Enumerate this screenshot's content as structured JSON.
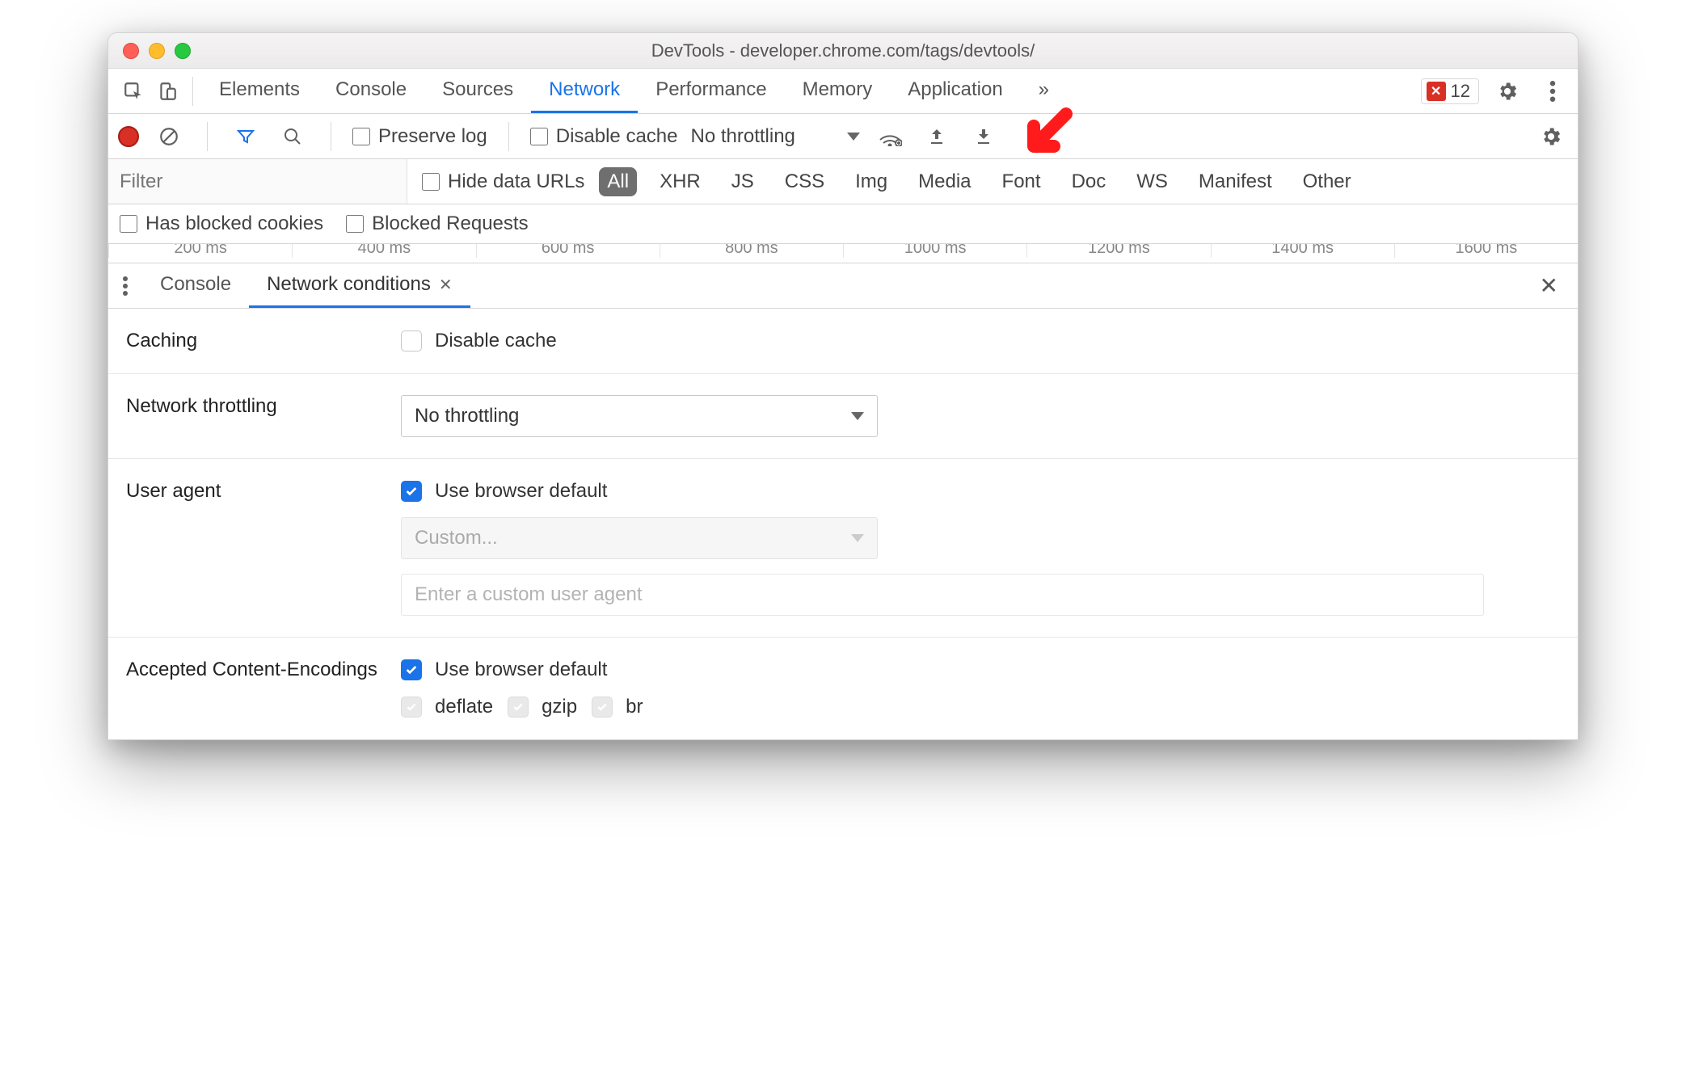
{
  "title": "DevTools - developer.chrome.com/tags/devtools/",
  "maintabs": [
    "Elements",
    "Console",
    "Sources",
    "Network",
    "Performance",
    "Memory",
    "Application"
  ],
  "maintabs_active": "Network",
  "errors_count": "12",
  "netbar": {
    "preserve_log": "Preserve log",
    "disable_cache": "Disable cache",
    "throttle": "No throttling"
  },
  "filter": {
    "placeholder": "Filter",
    "hide_data_urls": "Hide data URLs",
    "types": [
      "All",
      "XHR",
      "JS",
      "CSS",
      "Img",
      "Media",
      "Font",
      "Doc",
      "WS",
      "Manifest",
      "Other"
    ],
    "has_blocked_cookies": "Has blocked cookies",
    "blocked_requests": "Blocked Requests"
  },
  "timeline": [
    "200 ms",
    "400 ms",
    "600 ms",
    "800 ms",
    "1000 ms",
    "1200 ms",
    "1400 ms",
    "1600 ms"
  ],
  "drawer": {
    "tabs": [
      "Console",
      "Network conditions"
    ],
    "active": "Network conditions"
  },
  "settings": {
    "caching": {
      "label": "Caching",
      "disable_cache": "Disable cache"
    },
    "throttling": {
      "label": "Network throttling",
      "value": "No throttling"
    },
    "user_agent": {
      "label": "User agent",
      "use_default": "Use browser default",
      "custom_placeholder": "Custom...",
      "input_placeholder": "Enter a custom user agent"
    },
    "encodings": {
      "label": "Accepted Content-Encodings",
      "use_default": "Use browser default",
      "options": [
        "deflate",
        "gzip",
        "br"
      ]
    }
  }
}
